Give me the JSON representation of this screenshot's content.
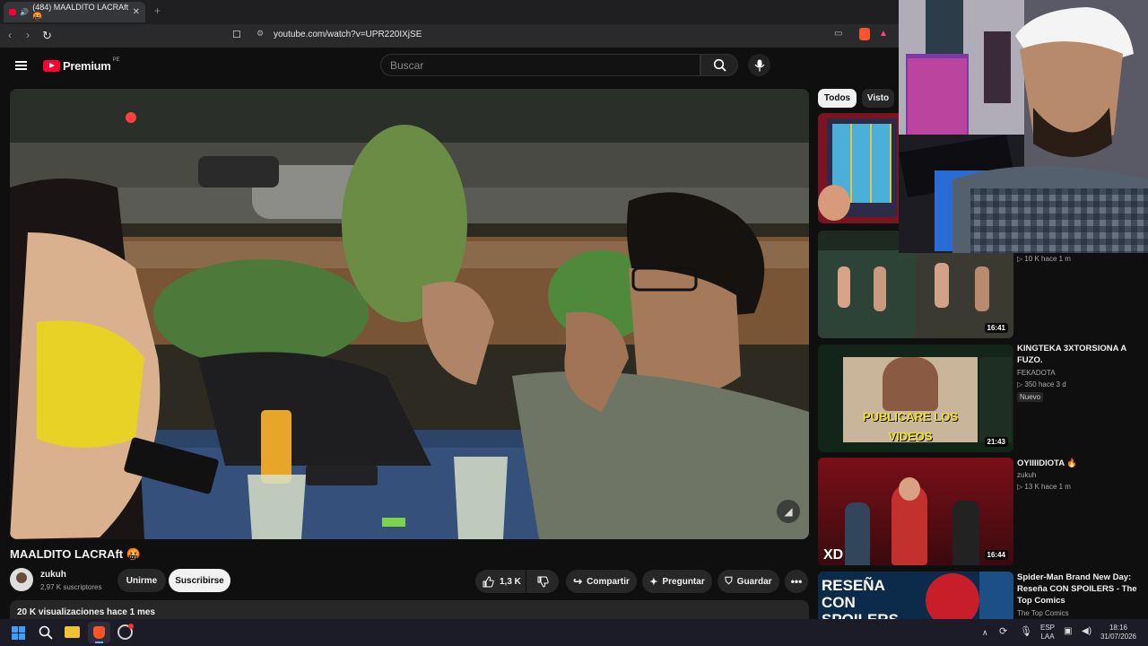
{
  "browser": {
    "tab_title": "(484) MAALDITO LACRAft 🤬",
    "tab_sound_icon": "speaker-icon",
    "new_tab": "+",
    "url": "youtube.com/watch?v=UPR220IXjSE"
  },
  "header": {
    "logo_text": "Premium",
    "logo_region": "PE",
    "search_placeholder": "Buscar"
  },
  "video": {
    "title": "MAALDITO LACRAft 🤬",
    "channel": "zukuh",
    "subscribers": "2,97 K suscriptores",
    "join_label": "Unirme",
    "subscribe_label": "Suscribirse",
    "likes": "1,3 K",
    "share_label": "Compartir",
    "ask_label": "Preguntar",
    "save_label": "Guardar",
    "views_date": "20 K visualizaciones  hace 1 mes"
  },
  "sidebar": {
    "chips": [
      {
        "label": "Todos",
        "active": true
      },
      {
        "label": "Visto",
        "active": false
      }
    ],
    "items": [
      {
        "title": "",
        "channel": "",
        "meta": "▷ 10 K   hace 1 m",
        "duration": "",
        "badge": ""
      },
      {
        "title": "",
        "channel": "",
        "meta": "",
        "duration": "16:41",
        "badge": ""
      },
      {
        "title": "KINGTEKA 3XTORSIONA A FUZO.",
        "channel": "FEKADOTA",
        "meta": "▷ 350   hace 3 d",
        "duration": "21:43",
        "badge": "Nuevo",
        "thumb_caption": "PUBLICARE LOS VIDEOS"
      },
      {
        "title": "OYIIIIDIOTA 🔥",
        "channel": "zukuh",
        "meta": "▷ 13 K   hace 1 m",
        "duration": "16:44",
        "badge": "",
        "thumb_caption": "XD"
      },
      {
        "title": "Spider-Man Brand New Day: Reseña CON SPOILERS - The Top Comics",
        "channel": "The Top Comics",
        "meta": "",
        "duration": "",
        "badge": "",
        "thumb_caption": "RESEÑA CON SPOILERS"
      }
    ]
  },
  "taskbar": {
    "lang_top": "ESP",
    "lang_bottom": "LAA",
    "time": "18:16",
    "date": "31/07/2026"
  },
  "colors": {
    "brand": "#ff0033",
    "bg": "#0f0f0f",
    "pill": "#272727"
  }
}
